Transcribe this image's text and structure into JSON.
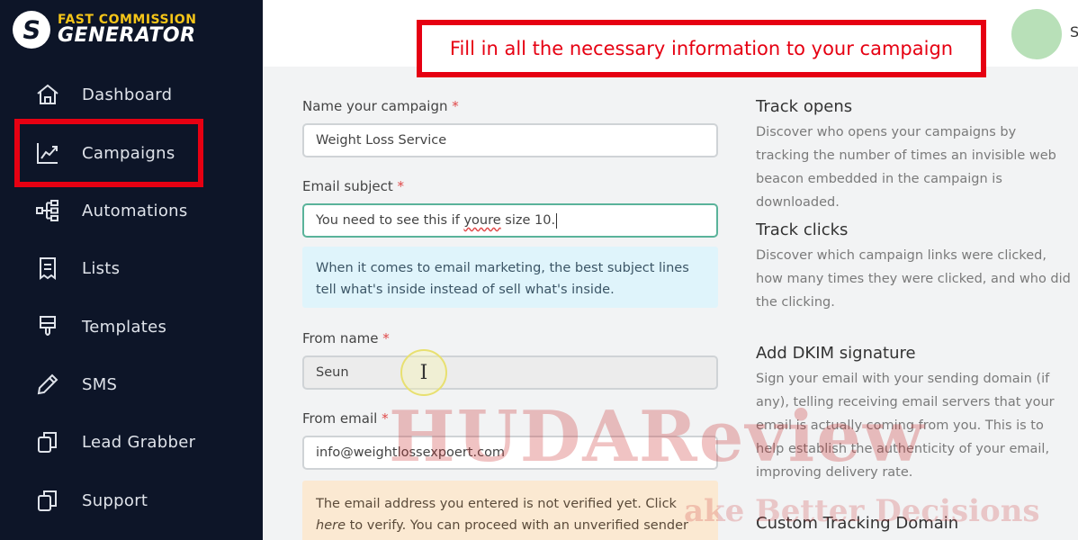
{
  "brand": {
    "top": "FAST COMMISSION",
    "bottom": "GENERATOR",
    "mark": "S"
  },
  "sidebar": {
    "items": [
      {
        "label": "Dashboard",
        "icon": "home-icon"
      },
      {
        "label": "Campaigns",
        "icon": "trending-up-icon"
      },
      {
        "label": "Automations",
        "icon": "flow-icon"
      },
      {
        "label": "Lists",
        "icon": "list-icon"
      },
      {
        "label": "Templates",
        "icon": "template-icon"
      },
      {
        "label": "SMS",
        "icon": "pencil-icon"
      },
      {
        "label": "Lead Grabber",
        "icon": "copy-icon"
      },
      {
        "label": "Support",
        "icon": "copy-icon"
      }
    ]
  },
  "header": {
    "callout": "Fill in all the necessary information to your campaign",
    "user_initial": "S"
  },
  "form": {
    "campaign_name": {
      "label": "Name your campaign",
      "required": "*",
      "value": "Weight Loss Service"
    },
    "email_subject": {
      "label": "Email subject",
      "required": "*",
      "value_prefix": "You need to see this if ",
      "value_misspelled": "youre",
      "value_suffix": " size 10."
    },
    "subject_tip": "When it comes to email marketing, the best subject lines tell what's inside instead of sell what's inside.",
    "from_name": {
      "label": "From name",
      "required": "*",
      "value": "Seun"
    },
    "from_email": {
      "label": "From email",
      "required": "*",
      "value": "info@weightlossexpoert.com"
    },
    "email_warning": {
      "before": "The email address you entered is not verified yet. Click ",
      "link": "here",
      "after": " to verify. You can proceed with an unverified sender anyway"
    }
  },
  "help": {
    "track_opens": {
      "title": "Track opens",
      "text": "Discover who opens your campaigns by tracking the number of times an invisible web beacon embedded in the campaign is downloaded."
    },
    "track_clicks": {
      "title": "Track clicks",
      "text": "Discover which campaign links were clicked, how many times they were clicked, and who did the clicking."
    },
    "dkim": {
      "title": "Add DKIM signature",
      "text": "Sign your email with your sending domain (if any), telling receiving email servers that your email is actually coming from you. This is to help establish the authenticity of your email, improving delivery rate."
    },
    "custom_domain": {
      "title": "Custom Tracking Domain"
    }
  },
  "watermark": {
    "main": "HUDAReview",
    "sub": "ake Better Decisions"
  },
  "colors": {
    "sidebar_bg": "#0d1528",
    "highlight_red": "#e60012",
    "focus_green": "#5ab39a",
    "info_bg": "#dff4fb",
    "warn_bg": "#fbe9d2"
  }
}
